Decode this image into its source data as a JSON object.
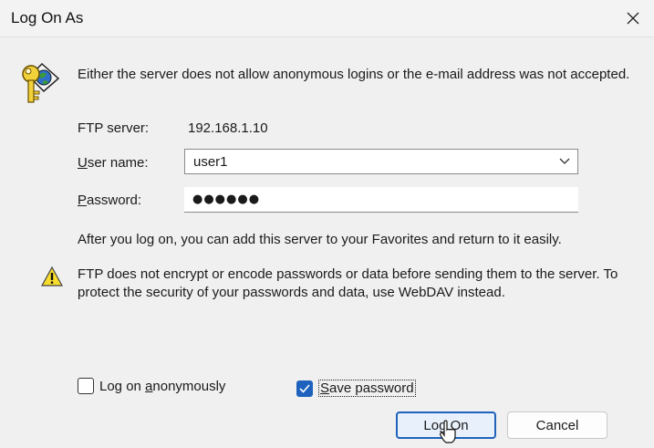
{
  "window": {
    "title": "Log On As",
    "close_glyph": "✕"
  },
  "message": "Either the server does not allow anonymous logins or the e-mail address was not accepted.",
  "form": {
    "server_label": "FTP server:",
    "server_value": "192.168.1.10",
    "username_label_underlined": "U",
    "username_label_rest": "ser name:",
    "username_value": "user1",
    "password_label_underlined": "P",
    "password_label_rest": "assword:",
    "password_value": "●●●●●●"
  },
  "info": "After you log on, you can add this server to your Favorites and return to it easily.",
  "warning": "FTP does not encrypt or encode passwords or data before sending them to the server.  To protect the security of your passwords and data, use WebDAV instead.",
  "checkboxes": {
    "anonymous_prefix": "Log on ",
    "anonymous_underlined": "a",
    "anonymous_suffix": "nonymously",
    "anonymous_checked": false,
    "save_underlined": "S",
    "save_suffix": "ave password",
    "save_checked": true
  },
  "buttons": {
    "logon_prefix": "Lo",
    "logon_underlined": "g",
    "logon_suffix": " On",
    "cancel": "Cancel"
  },
  "icons": {
    "key": "key-globe-icon",
    "warning": "warning-icon",
    "dropdown": "chevron-down-icon",
    "check": "checkmark-icon",
    "cursor": "hand-cursor-icon"
  },
  "colors": {
    "accent": "#1f62bd",
    "window_bg": "#f0f0f0"
  }
}
